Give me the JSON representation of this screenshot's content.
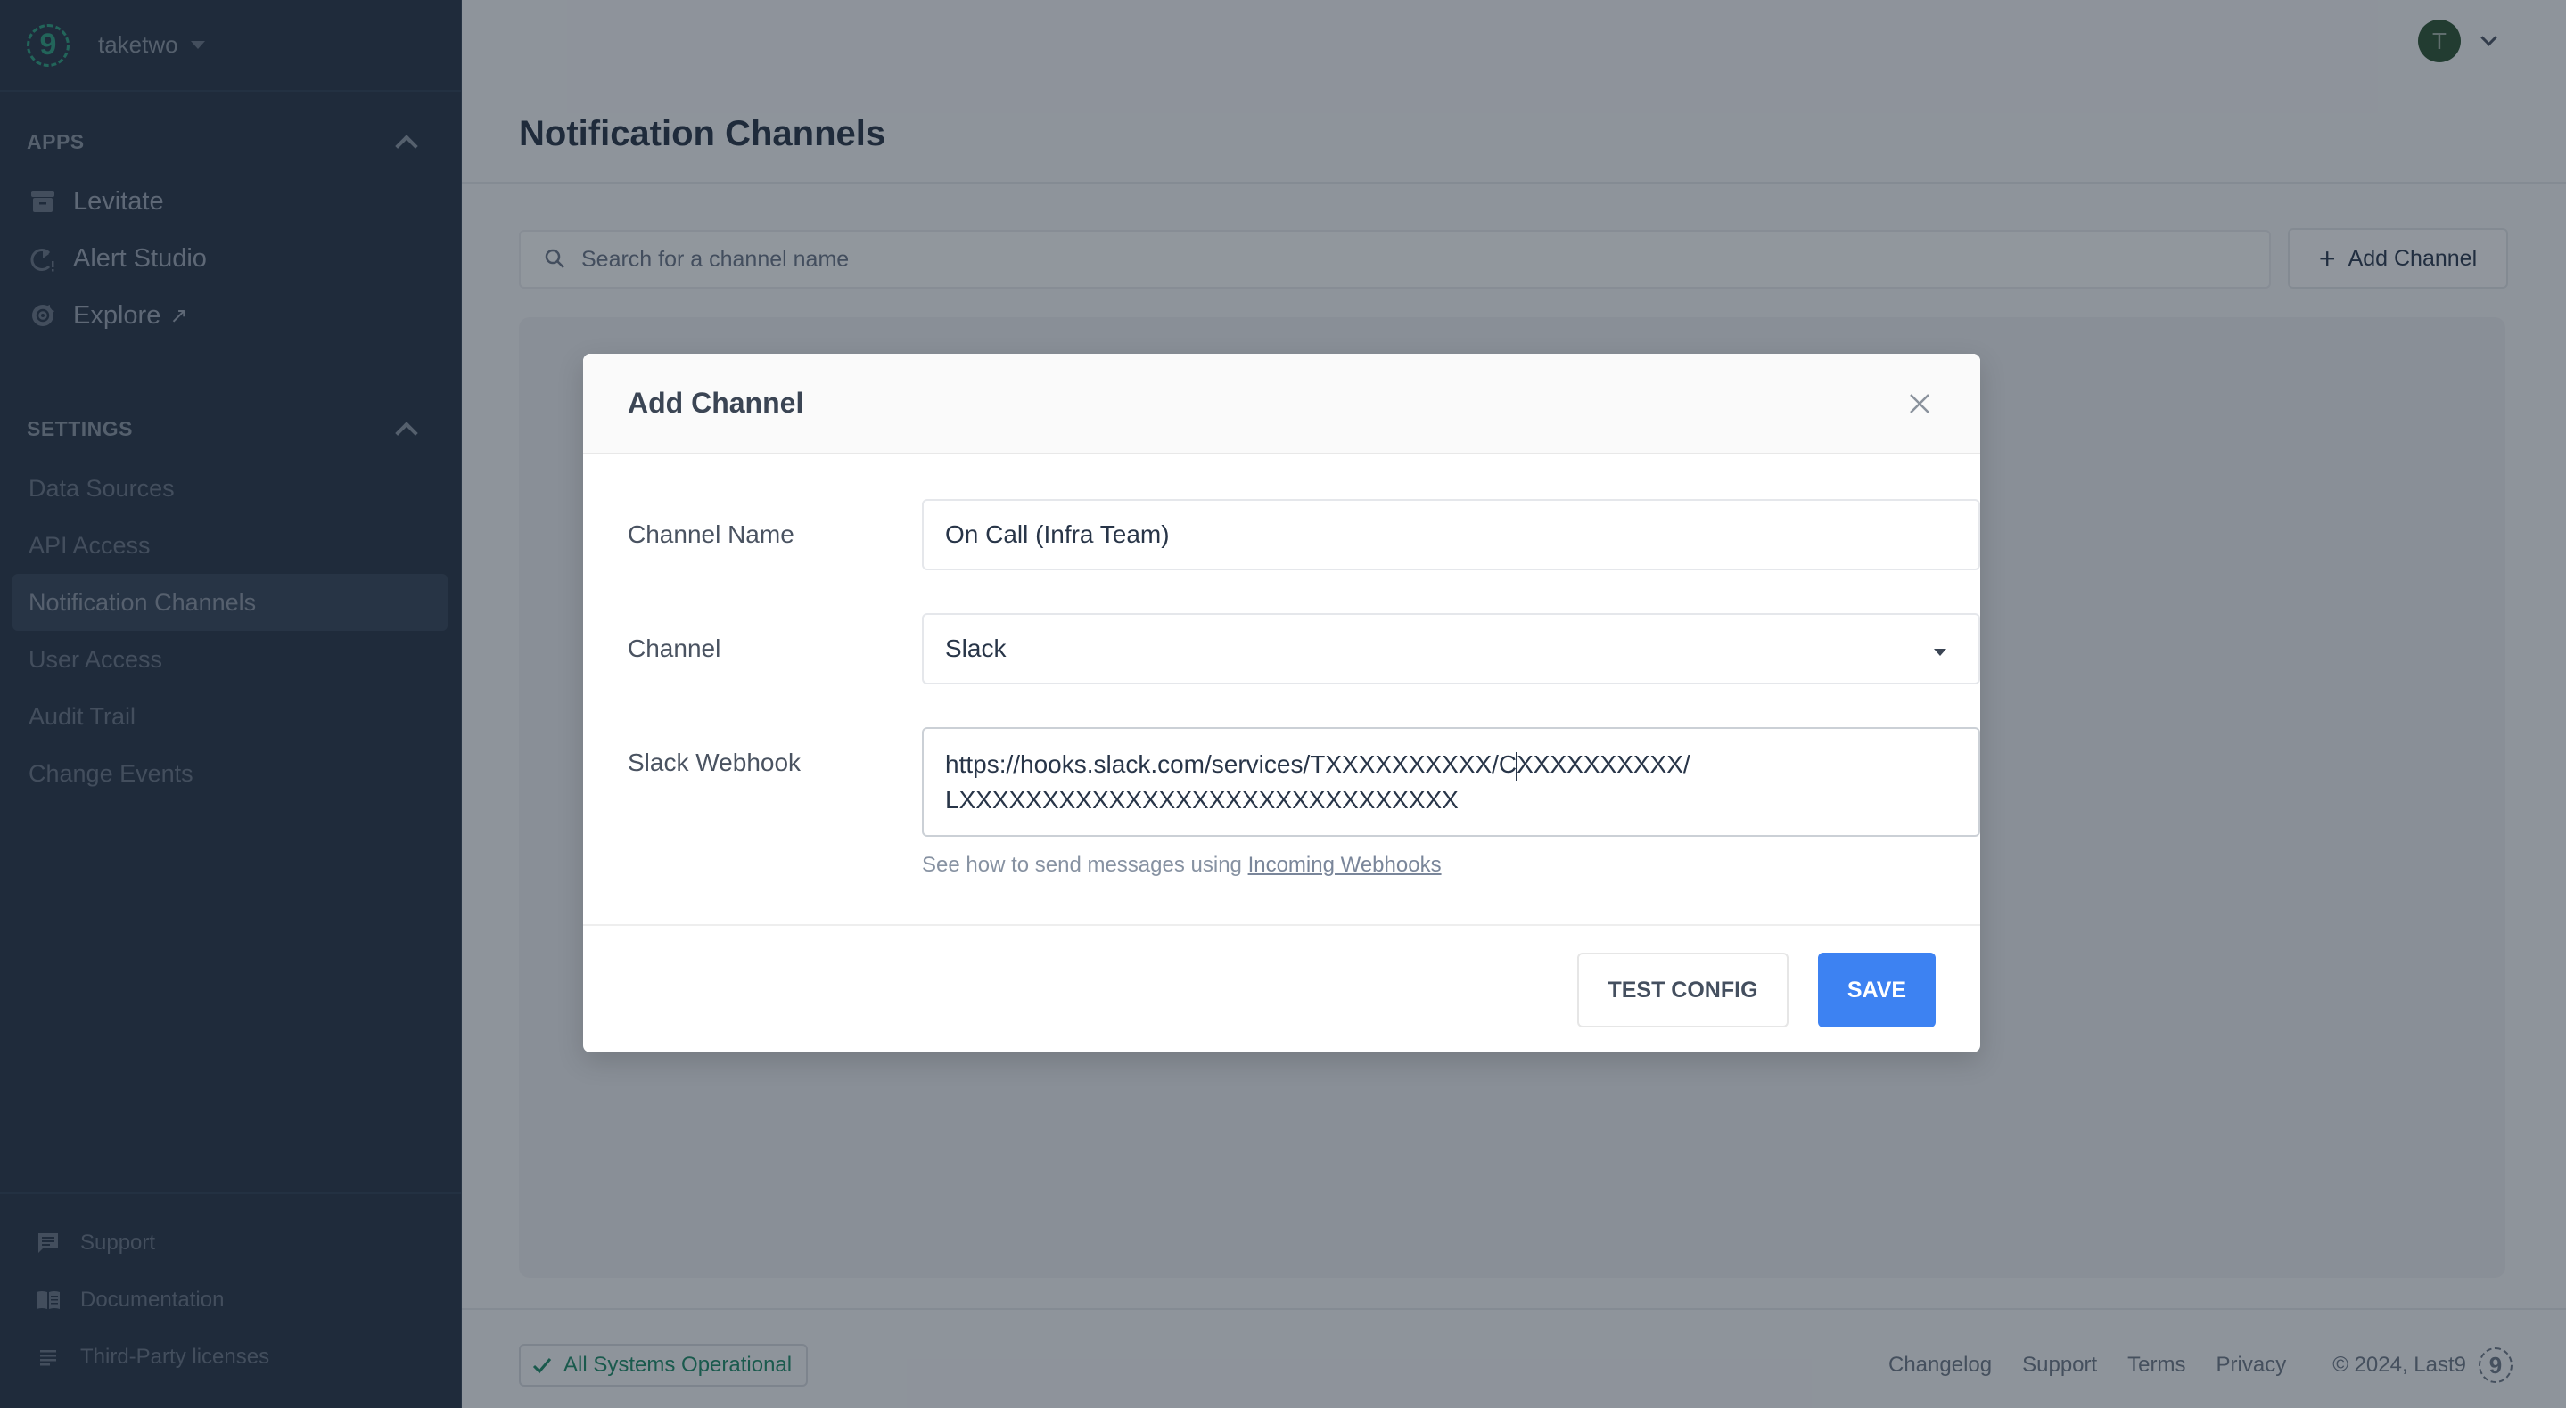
{
  "sidebar": {
    "org_name": "taketwo",
    "logo_text": "9",
    "apps": {
      "heading": "APPS",
      "items": [
        {
          "label": "Levitate",
          "icon": "archive-box-icon"
        },
        {
          "label": "Alert Studio",
          "icon": "alert-clock-icon"
        },
        {
          "label": "Explore",
          "icon": "grafana-icon",
          "external": "↗"
        }
      ]
    },
    "settings": {
      "heading": "SETTINGS",
      "items": [
        {
          "label": "Data Sources",
          "active": false
        },
        {
          "label": "API Access",
          "active": false
        },
        {
          "label": "Notification Channels",
          "active": true
        },
        {
          "label": "User Access",
          "active": false
        },
        {
          "label": "Audit Trail",
          "active": false
        },
        {
          "label": "Change Events",
          "active": false
        }
      ]
    },
    "bottom": [
      {
        "label": "Support",
        "icon": "chat-icon"
      },
      {
        "label": "Documentation",
        "icon": "book-icon"
      },
      {
        "label": "Third-Party licenses",
        "icon": "list-icon"
      }
    ]
  },
  "header": {
    "page_title": "Notification Channels",
    "avatar_initial": "T"
  },
  "toolbar": {
    "search_placeholder": "Search for a channel name",
    "search_value": "",
    "add_button_label": "Add Channel"
  },
  "modal": {
    "title": "Add Channel",
    "fields": {
      "channel_name": {
        "label": "Channel Name",
        "value": "On Call (Infra Team)"
      },
      "channel": {
        "label": "Channel",
        "value": "Slack"
      },
      "slack_webhook": {
        "label": "Slack Webhook",
        "value_before_cursor": "https://hooks.slack.com/services/TXXXXXXXXXX/C",
        "value_after_cursor": "XXXXXXXXXX/",
        "value_line2": "LXXXXXXXXXXXXXXXXXXXXXXXXXXXXXX"
      }
    },
    "helper_text": "See how to send messages using ",
    "helper_link": "Incoming Webhooks",
    "test_button_label": "TEST CONFIG",
    "save_button_label": "SAVE"
  },
  "footer": {
    "status_text": "All Systems Operational",
    "links": [
      "Changelog",
      "Support",
      "Terms",
      "Privacy"
    ],
    "copyright": "© 2024, Last9",
    "logo_text": "9"
  },
  "colors": {
    "sidebar_bg": "#283548",
    "brand_green": "#2f9e80",
    "primary_blue": "#3d82f2",
    "status_green": "#1f8a68",
    "avatar_bg": "#2e5435"
  }
}
